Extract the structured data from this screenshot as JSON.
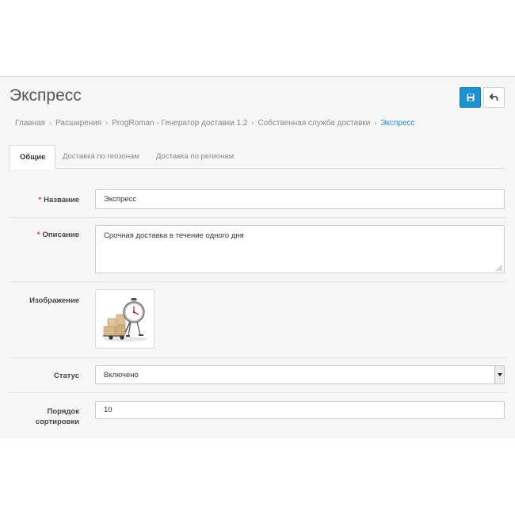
{
  "header": {
    "title": "Экспресс",
    "save_icon": "save-icon",
    "back_icon": "back-arrow-icon",
    "accent_color": "#1e91cf"
  },
  "breadcrumb": [
    "Главная",
    "Расширения",
    "ProgRoman - Генератор доставки 1.2",
    "Собственная служба доставки",
    "Экспресс"
  ],
  "tabs": [
    "Общие",
    "Доставка по геозонам",
    "Доставка по регионам"
  ],
  "form": {
    "name_label": "Название",
    "name_value": "Экспресс",
    "description_label": "Описание",
    "description_value": "Срочная доставка в течение одного дня",
    "image_label": "Изображение",
    "image_icon": "delivery-stopwatch-image",
    "status_label": "Статус",
    "status_value": "Включено",
    "sort_label_line1": "Порядок",
    "sort_label_line2": "сортировки",
    "sort_value": "10",
    "required_marker": "*"
  }
}
